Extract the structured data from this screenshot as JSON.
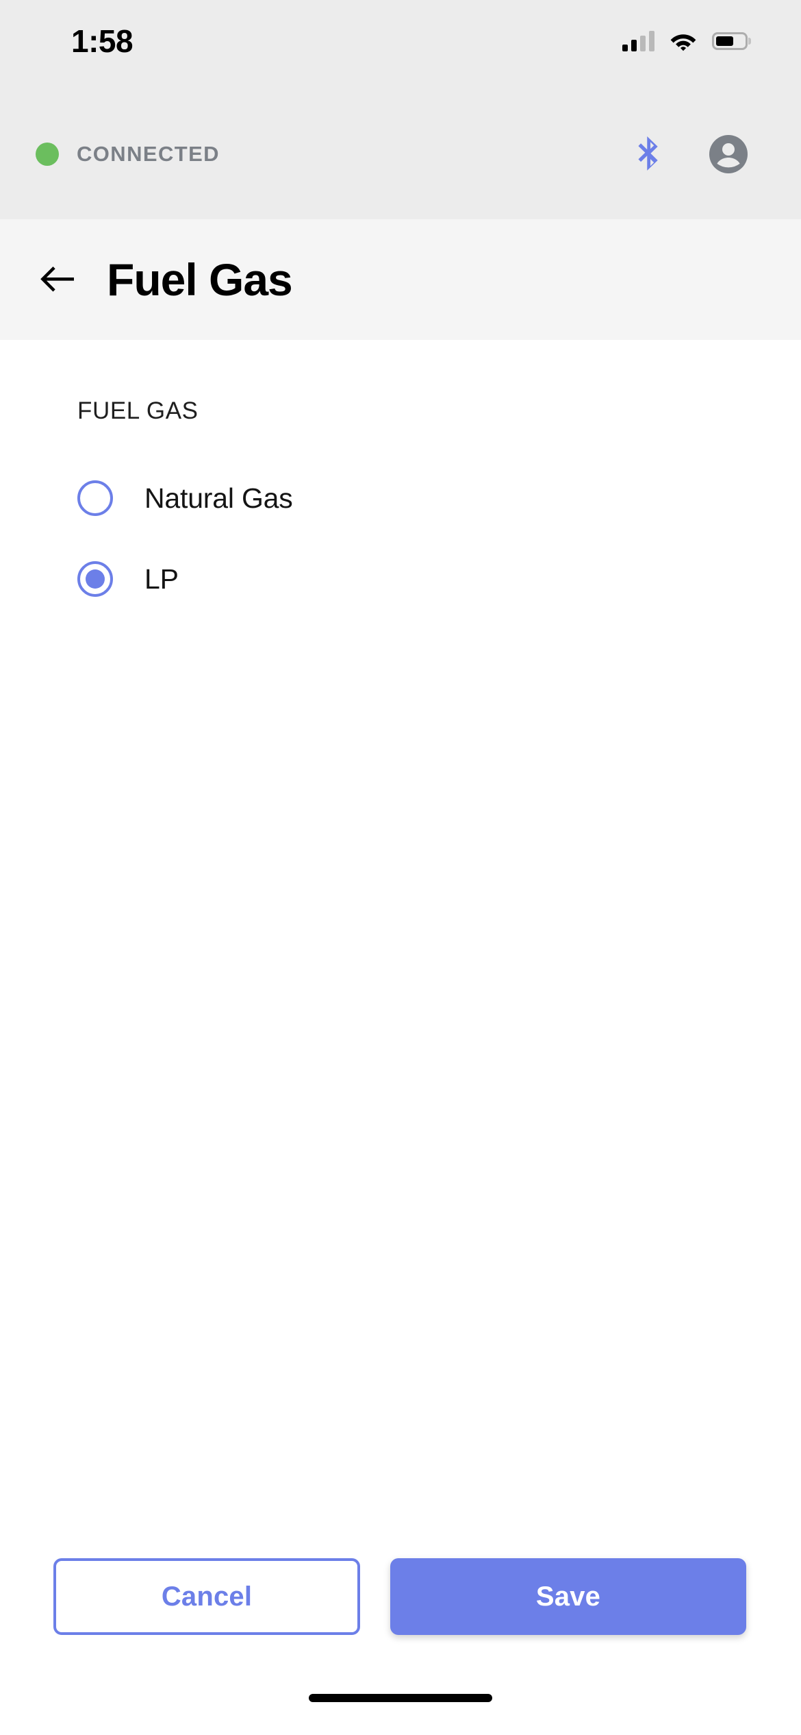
{
  "status_bar": {
    "time": "1:58",
    "cellular_icon": "cellular-signal-icon",
    "cellular_bars_filled": 2,
    "cellular_bars_total": 4,
    "wifi_icon": "wifi-icon",
    "battery_icon": "battery-icon",
    "battery_level_percent": 62
  },
  "connection_bar": {
    "status_text": "CONNECTED",
    "status_dot_color": "#6BBE5E",
    "bluetooth_icon": "bluetooth-icon",
    "bluetooth_color": "#6C7FE8",
    "account_icon": "account-circle-icon",
    "account_color": "#7B8087"
  },
  "header": {
    "back_icon": "arrow-left-icon",
    "title": "Fuel Gas"
  },
  "main": {
    "section_label": "FUEL GAS",
    "options": [
      {
        "label": "Natural Gas",
        "selected": false
      },
      {
        "label": "LP",
        "selected": true
      }
    ],
    "selected_value": "LP",
    "accent_color": "#6C7FE8"
  },
  "actions": {
    "cancel_label": "Cancel",
    "save_label": "Save"
  },
  "system": {
    "home_indicator": "home-indicator"
  }
}
